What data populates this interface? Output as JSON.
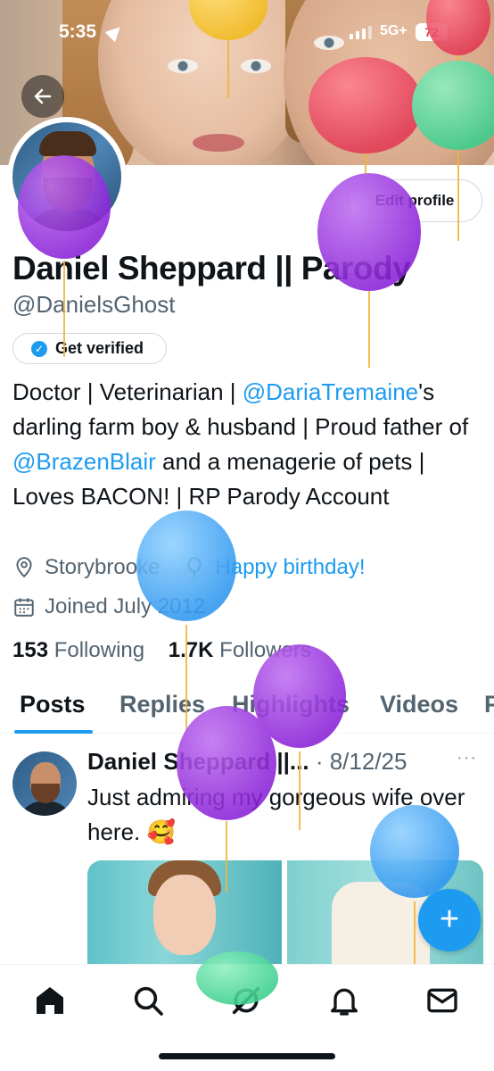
{
  "status_bar": {
    "time": "5:35",
    "network": "5G+",
    "battery": "72"
  },
  "profile": {
    "display_name": "Daniel Sheppard || Parody",
    "handle": "@DanielsGhost",
    "edit_profile_label": "Edit profile",
    "get_verified_label": "Get verified",
    "bio": {
      "part1": "Doctor | Veterinarian | ",
      "mention1": "@DariaTremaine",
      "part2": "'s darling farm boy & husband | Proud father of ",
      "mention2": "@BrazenBlair",
      "part3": " and a menagerie of pets | Loves BACON! | RP Parody Account"
    },
    "location": "Storybrooke",
    "birthday": "Happy birthday!",
    "joined": "Joined July 2012",
    "following_count": "153",
    "following_label": "Following",
    "followers_count": "1.7K",
    "followers_label": "Followers"
  },
  "tabs": [
    {
      "label": "Posts",
      "active": true
    },
    {
      "label": "Replies",
      "active": false
    },
    {
      "label": "Highlights",
      "active": false
    },
    {
      "label": "Videos",
      "active": false
    },
    {
      "label": "P",
      "active": false
    }
  ],
  "post": {
    "author": "Daniel Sheppard ||...",
    "separator": " · ",
    "date": "8/12/25",
    "more": "···",
    "text": "Just admiring my gorgeous wife over here. 🥰"
  },
  "fab_label": "+",
  "colors": {
    "accent": "#1d9bf0",
    "text": "#0f1419",
    "muted": "#536471"
  },
  "icons": {
    "back": "arrow-left-icon",
    "search": "search-icon",
    "more": "more-icon",
    "share": "share-icon",
    "location": "location-pin-icon",
    "birthday": "balloon-icon",
    "calendar": "calendar-icon",
    "home": "home-icon",
    "grok": "grok-icon",
    "notifications": "bell-icon",
    "messages": "envelope-icon"
  }
}
